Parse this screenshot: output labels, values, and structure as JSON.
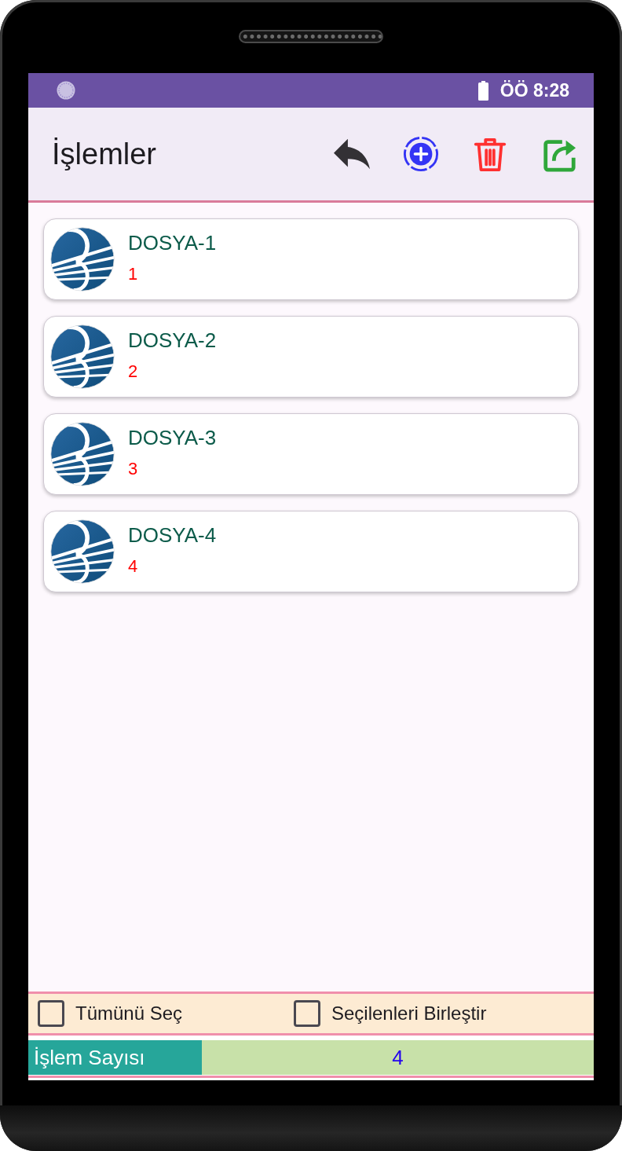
{
  "status_bar": {
    "time": "ÖÖ 8:28"
  },
  "app_bar": {
    "title": "İşlemler"
  },
  "files": [
    {
      "title": "DOSYA-1",
      "number": "1"
    },
    {
      "title": "DOSYA-2",
      "number": "2"
    },
    {
      "title": "DOSYA-3",
      "number": "3"
    },
    {
      "title": "DOSYA-4",
      "number": "4"
    }
  ],
  "options": [
    {
      "label": "Tümünü Seç",
      "checked": false
    },
    {
      "label": "Seçilenleri Birleştir",
      "checked": false
    }
  ],
  "summary": {
    "label": "İşlem Sayısı",
    "value": "4"
  }
}
